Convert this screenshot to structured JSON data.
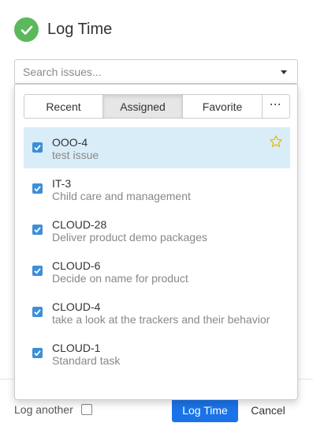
{
  "header": {
    "title": "Log Time",
    "icon": "check-circle-icon",
    "icon_color": "#5cb85c"
  },
  "search": {
    "placeholder": "Search issues...",
    "value": ""
  },
  "tabs": [
    {
      "label": "Recent",
      "active": false
    },
    {
      "label": "Assigned",
      "active": true
    },
    {
      "label": "Favorite",
      "active": false
    },
    {
      "label": "···",
      "active": false
    }
  ],
  "issues": [
    {
      "key": "OOO-4",
      "summary": "test issue",
      "checked": true,
      "selected": true,
      "favorite_icon": "star-outline-icon"
    },
    {
      "key": "IT-3",
      "summary": "Child care and management",
      "checked": true,
      "selected": false
    },
    {
      "key": "CLOUD-28",
      "summary": "Deliver product demo packages",
      "checked": true,
      "selected": false
    },
    {
      "key": "CLOUD-6",
      "summary": "Decide on name for product",
      "checked": true,
      "selected": false
    },
    {
      "key": "CLOUD-4",
      "summary": "take a look at the trackers and their behavior",
      "checked": true,
      "selected": false
    },
    {
      "key": "CLOUD-1",
      "summary": "Standard task",
      "checked": true,
      "selected": false
    }
  ],
  "footer": {
    "log_another_label": "Log another",
    "log_another_checked": false,
    "submit_label": "Log Time",
    "cancel_label": "Cancel"
  },
  "colors": {
    "accent": "#1a73e8",
    "checkbox": "#3d8fd8",
    "selected_row": "#d9edf8",
    "star": "#e6b800"
  }
}
